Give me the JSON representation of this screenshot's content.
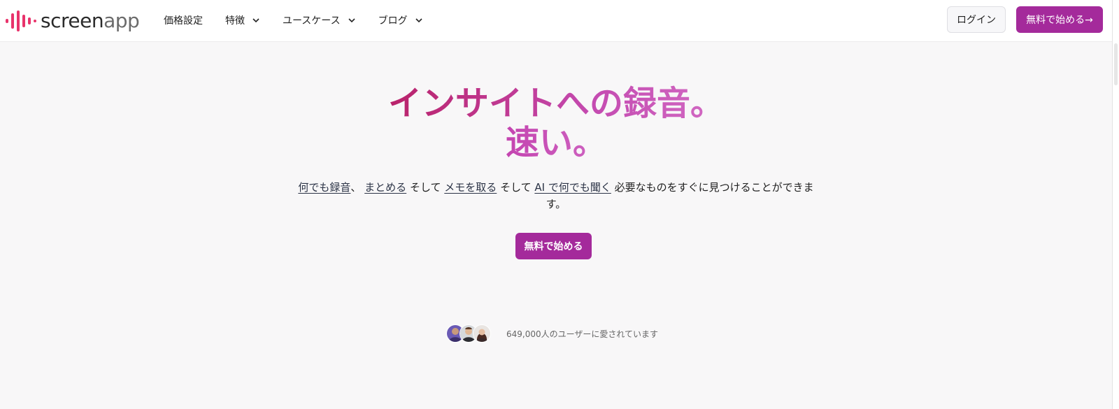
{
  "header": {
    "logo_text_a": "screen",
    "logo_text_b": "app",
    "nav": [
      {
        "label": "価格設定",
        "has_dropdown": false
      },
      {
        "label": "特徴",
        "has_dropdown": true
      },
      {
        "label": "ユースケース",
        "has_dropdown": true
      },
      {
        "label": "ブログ",
        "has_dropdown": true
      }
    ],
    "login_label": "ログイン",
    "start_label": "無料で始める→"
  },
  "hero": {
    "title_line1": "インサイトへの録音。",
    "title_line2": "速い。",
    "subtitle": {
      "link1": "何でも録音",
      "sep1": "、",
      "link2": "まとめる",
      "sep2": " そして ",
      "link3": "メモを取る",
      "sep3": " そして ",
      "link4": "AI で何でも聞く",
      "tail": " 必要なものをすぐに見つけることができます。"
    },
    "cta_label": "無料で始める"
  },
  "social_proof": {
    "text": "649,000人のユーザーに愛されています"
  },
  "colors": {
    "brand": "#a42a9b",
    "logo_pink": "#e8336b",
    "title_gradient_start": "#b9226a",
    "title_gradient_end": "#d26bc4"
  }
}
